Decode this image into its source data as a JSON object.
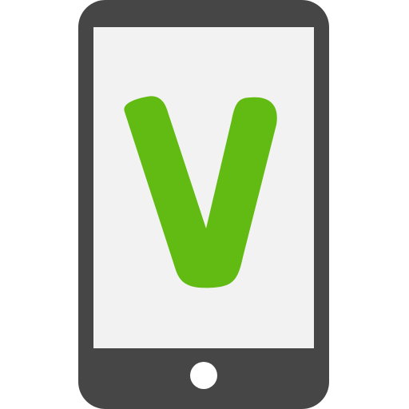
{
  "icon": {
    "name": "mobile-phone-v-logo-icon",
    "device_icon": "smartphone-icon",
    "logo_icon": "letter-v-logo-icon",
    "home_button_icon": "home-button-icon"
  },
  "colors": {
    "device_body": "#464646",
    "screen": "#f2f2f2",
    "logo": "#62bb12",
    "home_button": "#ffffff"
  }
}
